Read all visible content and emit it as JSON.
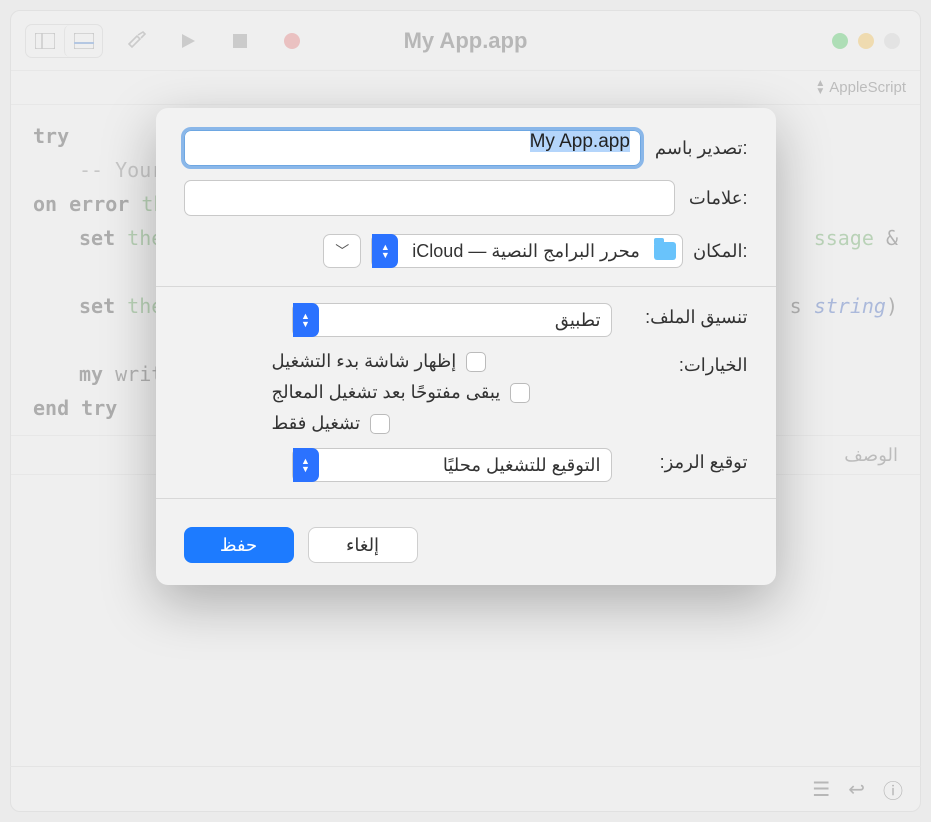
{
  "window": {
    "title": "My App.app",
    "language_dropdown": "AppleScript"
  },
  "code": {
    "l1": "try",
    "l2": "-- Your ",
    "l3a": "on error",
    "l3b": " the",
    "l4a": "set",
    "l4b": " the",
    "l4tail_green": "ssage",
    "l4tail_amp": " &",
    "l5a": "set",
    "l5b": " the",
    "l5tail_black": "s ",
    "l5tail_blue": "string",
    "l5tail_paren": ")",
    "l6a": "my",
    "l6b": " writ",
    "l7": "end try"
  },
  "desc": {
    "label": "الوصف"
  },
  "dialog": {
    "export_as_label": "تصدير باسم:",
    "export_as_value": "My App.app",
    "tags_label": "علامات:",
    "tags_value": "",
    "location_label": "المكان:",
    "location_value": "محرر البرامج النصية — iCloud",
    "file_format_label": "تنسيق الملف:",
    "file_format_value": "تطبيق",
    "options_label": "الخيارات:",
    "opt_show_startup": "إظهار شاشة بدء التشغيل",
    "opt_stay_open": "يبقى مفتوحًا بعد تشغيل المعالج",
    "opt_run_only": "تشغيل فقط",
    "code_sign_label": "توقيع الرمز:",
    "code_sign_value": "التوقيع للتشغيل محليًا",
    "save": "حفظ",
    "cancel": "إلغاء"
  }
}
